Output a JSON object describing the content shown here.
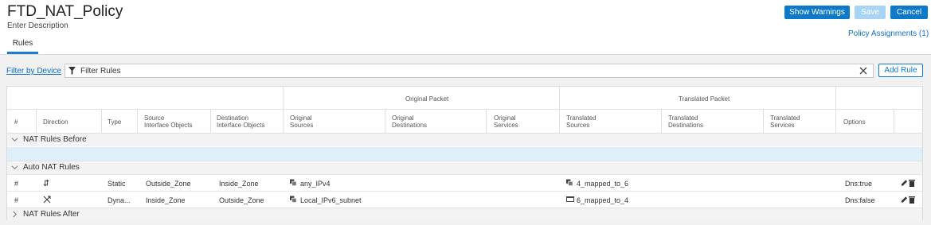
{
  "header": {
    "title": "FTD_NAT_Policy",
    "description": "Enter Description",
    "show_warnings": "Show Warnings",
    "save": "Save",
    "cancel": "Cancel",
    "policy_assignments": "Policy Assignments (1)",
    "tab_rules": "Rules"
  },
  "toolbar": {
    "filter_by_device": "Filter by Device",
    "filter_placeholder": "Filter Rules",
    "add_rule": "Add Rule"
  },
  "table": {
    "group_original": "Original Packet",
    "group_translated": "Translated Packet",
    "columns": {
      "num": "#",
      "direction": "Direction",
      "type": "Type",
      "src_intf_1": "Source",
      "src_intf_2": "Interface Objects",
      "dst_intf_1": "Destination",
      "dst_intf_2": "Interface Objects",
      "orig_src_1": "Original",
      "orig_src_2": "Sources",
      "orig_dst_1": "Original",
      "orig_dst_2": "Destinations",
      "orig_svc_1": "Original",
      "orig_svc_2": "Services",
      "tr_src_1": "Translated",
      "tr_src_2": "Sources",
      "tr_dst_1": "Translated",
      "tr_dst_2": "Destinations",
      "tr_svc_1": "Translated",
      "tr_svc_2": "Services",
      "options": "Options"
    },
    "sections": {
      "before": "NAT Rules Before",
      "auto": "Auto NAT Rules",
      "after": "NAT Rules After"
    },
    "rows": [
      {
        "num": "#",
        "type": "Static",
        "src_intf": "Outside_Zone",
        "dst_intf": "Inside_Zone",
        "orig_src": "any_IPv4",
        "tr_src": "4_mapped_to_6",
        "options": "Dns:true"
      },
      {
        "num": "#",
        "type": "Dyna...",
        "src_intf": "Inside_Zone",
        "dst_intf": "Outside_Zone",
        "orig_src": "Local_IPv6_subnet",
        "tr_src": "6_mapped_to_4",
        "options": "Dns:false"
      }
    ]
  },
  "icons": {
    "filter": "filter-icon",
    "clear": "close-icon",
    "edit": "pencil-icon",
    "delete": "trash-icon",
    "network_group": "network-group-icon",
    "network": "network-icon",
    "static_direction": "bidirectional-arrow-icon",
    "dynamic_direction": "unidirectional-arrow-icon"
  },
  "colors": {
    "primary": "#0e78c9",
    "primary_disabled": "#a7d4f4",
    "link": "#0f6fc6",
    "selected_row": "#dfeffa"
  }
}
